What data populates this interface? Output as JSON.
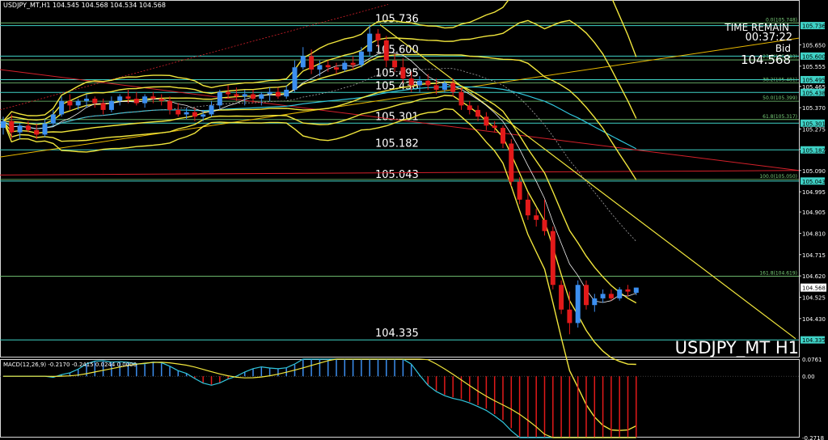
{
  "header": "USDJPY_MT,H1  104.545 104.568 104.534 104.568",
  "overlay": {
    "time_remain_label": "TIME REMAIN",
    "time_remain_value": "00:37:22",
    "bid_label": "Bid",
    "bid_value": "104.568",
    "watermark": "USDJPY_MT H1"
  },
  "macd_header": "MACD(12,26,9) -0.2170 -0.2415 0.0244 0.0000",
  "colors": {
    "background": "#000000",
    "bull": "#3c8ff0",
    "bear": "#e21a1a",
    "band": "#f1e63c",
    "cyan_ma": "#31c6dc",
    "level_line": "#3fd2c6",
    "red_trend": "#d4202a",
    "fib_line": "#7ad07a",
    "axis_text": "#ffffff"
  },
  "chart_data": [
    {
      "type": "candlestick",
      "symbol": "USDJPY_MT",
      "timeframe": "H1",
      "ylim": [
        104.26,
        105.85
      ],
      "candles": [
        {
          "o": 105.28,
          "h": 105.33,
          "l": 105.25,
          "c": 105.31
        },
        {
          "o": 105.31,
          "h": 105.34,
          "l": 105.23,
          "c": 105.26
        },
        {
          "o": 105.26,
          "h": 105.3,
          "l": 105.23,
          "c": 105.29
        },
        {
          "o": 105.29,
          "h": 105.31,
          "l": 105.26,
          "c": 105.27
        },
        {
          "o": 105.27,
          "h": 105.3,
          "l": 105.23,
          "c": 105.25
        },
        {
          "o": 105.25,
          "h": 105.32,
          "l": 105.24,
          "c": 105.3
        },
        {
          "o": 105.3,
          "h": 105.36,
          "l": 105.29,
          "c": 105.34
        },
        {
          "o": 105.34,
          "h": 105.42,
          "l": 105.33,
          "c": 105.4
        },
        {
          "o": 105.4,
          "h": 105.43,
          "l": 105.36,
          "c": 105.38
        },
        {
          "o": 105.38,
          "h": 105.41,
          "l": 105.36,
          "c": 105.4
        },
        {
          "o": 105.4,
          "h": 105.43,
          "l": 105.37,
          "c": 105.41
        },
        {
          "o": 105.41,
          "h": 105.42,
          "l": 105.37,
          "c": 105.39
        },
        {
          "o": 105.39,
          "h": 105.41,
          "l": 105.34,
          "c": 105.36
        },
        {
          "o": 105.36,
          "h": 105.42,
          "l": 105.35,
          "c": 105.4
        },
        {
          "o": 105.4,
          "h": 105.43,
          "l": 105.38,
          "c": 105.42
        },
        {
          "o": 105.42,
          "h": 105.45,
          "l": 105.39,
          "c": 105.41
        },
        {
          "o": 105.41,
          "h": 105.44,
          "l": 105.38,
          "c": 105.39
        },
        {
          "o": 105.39,
          "h": 105.43,
          "l": 105.37,
          "c": 105.42
        },
        {
          "o": 105.42,
          "h": 105.44,
          "l": 105.39,
          "c": 105.41
        },
        {
          "o": 105.41,
          "h": 105.43,
          "l": 105.38,
          "c": 105.4
        },
        {
          "o": 105.4,
          "h": 105.42,
          "l": 105.34,
          "c": 105.36
        },
        {
          "o": 105.36,
          "h": 105.39,
          "l": 105.33,
          "c": 105.34
        },
        {
          "o": 105.34,
          "h": 105.37,
          "l": 105.32,
          "c": 105.35
        },
        {
          "o": 105.35,
          "h": 105.37,
          "l": 105.31,
          "c": 105.33
        },
        {
          "o": 105.33,
          "h": 105.36,
          "l": 105.31,
          "c": 105.34
        },
        {
          "o": 105.34,
          "h": 105.4,
          "l": 105.33,
          "c": 105.38
        },
        {
          "o": 105.38,
          "h": 105.45,
          "l": 105.36,
          "c": 105.44
        },
        {
          "o": 105.44,
          "h": 105.47,
          "l": 105.41,
          "c": 105.43
        },
        {
          "o": 105.43,
          "h": 105.46,
          "l": 105.4,
          "c": 105.42
        },
        {
          "o": 105.42,
          "h": 105.45,
          "l": 105.38,
          "c": 105.43
        },
        {
          "o": 105.43,
          "h": 105.45,
          "l": 105.39,
          "c": 105.41
        },
        {
          "o": 105.41,
          "h": 105.44,
          "l": 105.38,
          "c": 105.43
        },
        {
          "o": 105.43,
          "h": 105.46,
          "l": 105.4,
          "c": 105.44
        },
        {
          "o": 105.44,
          "h": 105.46,
          "l": 105.41,
          "c": 105.42
        },
        {
          "o": 105.42,
          "h": 105.47,
          "l": 105.41,
          "c": 105.45
        },
        {
          "o": 105.45,
          "h": 105.58,
          "l": 105.44,
          "c": 105.55
        },
        {
          "o": 105.55,
          "h": 105.64,
          "l": 105.54,
          "c": 105.6
        },
        {
          "o": 105.6,
          "h": 105.63,
          "l": 105.52,
          "c": 105.54
        },
        {
          "o": 105.54,
          "h": 105.58,
          "l": 105.51,
          "c": 105.56
        },
        {
          "o": 105.56,
          "h": 105.58,
          "l": 105.53,
          "c": 105.55
        },
        {
          "o": 105.55,
          "h": 105.57,
          "l": 105.52,
          "c": 105.54
        },
        {
          "o": 105.54,
          "h": 105.58,
          "l": 105.53,
          "c": 105.57
        },
        {
          "o": 105.57,
          "h": 105.6,
          "l": 105.54,
          "c": 105.56
        },
        {
          "o": 105.56,
          "h": 105.64,
          "l": 105.55,
          "c": 105.62
        },
        {
          "o": 105.62,
          "h": 105.74,
          "l": 105.6,
          "c": 105.7
        },
        {
          "o": 105.7,
          "h": 105.72,
          "l": 105.64,
          "c": 105.67
        },
        {
          "o": 105.67,
          "h": 105.69,
          "l": 105.55,
          "c": 105.58
        },
        {
          "o": 105.58,
          "h": 105.61,
          "l": 105.53,
          "c": 105.55
        },
        {
          "o": 105.55,
          "h": 105.59,
          "l": 105.48,
          "c": 105.5
        },
        {
          "o": 105.5,
          "h": 105.53,
          "l": 105.44,
          "c": 105.47
        },
        {
          "o": 105.47,
          "h": 105.51,
          "l": 105.44,
          "c": 105.49
        },
        {
          "o": 105.49,
          "h": 105.52,
          "l": 105.45,
          "c": 105.47
        },
        {
          "o": 105.47,
          "h": 105.5,
          "l": 105.43,
          "c": 105.45
        },
        {
          "o": 105.45,
          "h": 105.49,
          "l": 105.44,
          "c": 105.48
        },
        {
          "o": 105.48,
          "h": 105.5,
          "l": 105.42,
          "c": 105.44
        },
        {
          "o": 105.44,
          "h": 105.46,
          "l": 105.36,
          "c": 105.38
        },
        {
          "o": 105.38,
          "h": 105.4,
          "l": 105.34,
          "c": 105.36
        },
        {
          "o": 105.36,
          "h": 105.38,
          "l": 105.31,
          "c": 105.33
        },
        {
          "o": 105.33,
          "h": 105.35,
          "l": 105.27,
          "c": 105.29
        },
        {
          "o": 105.29,
          "h": 105.31,
          "l": 105.26,
          "c": 105.28
        },
        {
          "o": 105.28,
          "h": 105.29,
          "l": 105.19,
          "c": 105.21
        },
        {
          "o": 105.21,
          "h": 105.23,
          "l": 105.02,
          "c": 105.04
        },
        {
          "o": 105.04,
          "h": 105.06,
          "l": 104.94,
          "c": 104.96
        },
        {
          "o": 104.96,
          "h": 104.99,
          "l": 104.87,
          "c": 104.89
        },
        {
          "o": 104.89,
          "h": 104.92,
          "l": 104.84,
          "c": 104.87
        },
        {
          "o": 104.87,
          "h": 104.96,
          "l": 104.8,
          "c": 104.82
        },
        {
          "o": 104.82,
          "h": 104.84,
          "l": 104.56,
          "c": 104.58
        },
        {
          "o": 104.58,
          "h": 104.6,
          "l": 104.45,
          "c": 104.47
        },
        {
          "o": 104.47,
          "h": 104.55,
          "l": 104.36,
          "c": 104.41
        },
        {
          "o": 104.41,
          "h": 104.6,
          "l": 104.39,
          "c": 104.58
        },
        {
          "o": 104.58,
          "h": 104.6,
          "l": 104.47,
          "c": 104.49
        },
        {
          "o": 104.49,
          "h": 104.54,
          "l": 104.46,
          "c": 104.52
        },
        {
          "o": 104.52,
          "h": 104.56,
          "l": 104.5,
          "c": 104.54
        },
        {
          "o": 104.54,
          "h": 104.56,
          "l": 104.51,
          "c": 104.52
        },
        {
          "o": 104.52,
          "h": 104.57,
          "l": 104.51,
          "c": 104.56
        },
        {
          "o": 104.56,
          "h": 104.58,
          "l": 104.53,
          "c": 104.55
        },
        {
          "o": 104.545,
          "h": 104.568,
          "l": 104.534,
          "c": 104.568
        }
      ],
      "price_axis_ticks": [
        "105.650",
        "105.555",
        "105.465",
        "105.370",
        "105.275",
        "105.185",
        "105.090",
        "104.995",
        "104.905",
        "104.810",
        "104.715",
        "104.620",
        "104.525",
        "104.430"
      ],
      "level_lines": [
        {
          "price": 105.736,
          "label": "105.736",
          "tag": "105.736"
        },
        {
          "price": 105.6,
          "label": "105.600",
          "tag": "105.600"
        },
        {
          "price": 105.495,
          "label": "105.495",
          "tag": "105.495"
        },
        {
          "price": 105.438,
          "label": "105.438",
          "tag": "105.438"
        },
        {
          "price": 105.301,
          "label": "105.301",
          "tag": "105.301"
        },
        {
          "price": 105.182,
          "label": "105.182",
          "tag": "105.182"
        },
        {
          "price": 105.043,
          "label": "105.043",
          "tag": "105.043"
        },
        {
          "price": 104.335,
          "label": "104.335",
          "tag": "104.335"
        }
      ],
      "current_price": {
        "price": 104.568,
        "tag": "104.568"
      },
      "fibonacci": [
        {
          "price": 105.748,
          "label": "0.0(105.748)"
        },
        {
          "price": 105.583,
          "label": "23.6(105.583)"
        },
        {
          "price": 105.481,
          "label": "38.2(105.481)"
        },
        {
          "price": 105.399,
          "label": "50.0(105.399)"
        },
        {
          "price": 105.317,
          "label": "61.8(105.317)"
        },
        {
          "price": 105.05,
          "label": "100.0(105.050)"
        },
        {
          "price": 104.619,
          "label": "161.8(104.619)"
        }
      ]
    },
    {
      "type": "histogram",
      "indicator": "MACD(12,26,9)",
      "ylim": [
        -0.2718,
        0.0761
      ],
      "axis_ticks": [
        "0.0761",
        "0.00",
        "-0.2718"
      ],
      "zero": 0.0,
      "note": "histogram bars approximate MACD values per candle"
    }
  ]
}
